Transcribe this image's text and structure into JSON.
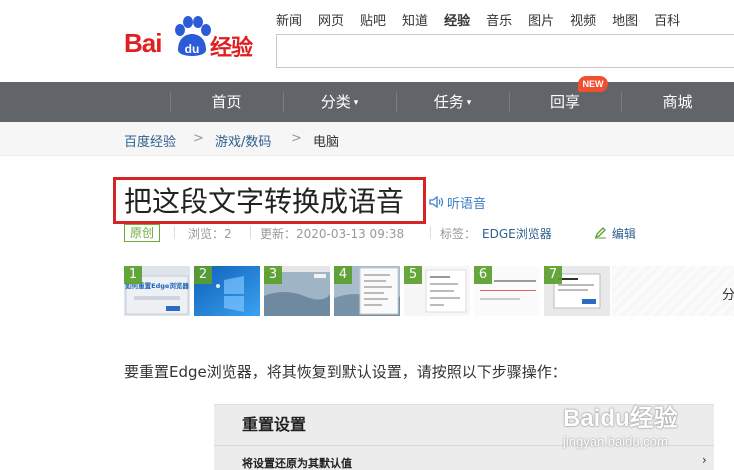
{
  "brand": {
    "logo_bai": "Bai",
    "logo_du": "du",
    "logo_jingyan": "经验",
    "watermark_text": "Baidu经验",
    "watermark_url": "jingyan.baidu.com"
  },
  "top_nav": {
    "items": [
      "新闻",
      "网页",
      "贴吧",
      "知道",
      "经验",
      "音乐",
      "图片",
      "视频",
      "地图",
      "百科"
    ],
    "active_index": 4
  },
  "main_nav": {
    "items": [
      {
        "label": "首页",
        "caret": ""
      },
      {
        "label": "分类",
        "caret": "▾"
      },
      {
        "label": "任务",
        "caret": "▾"
      },
      {
        "label": "回享",
        "caret": ""
      },
      {
        "label": "商城",
        "caret": ""
      }
    ],
    "new_badge": "NEW"
  },
  "breadcrumb": {
    "items": [
      "百度经验",
      "游戏/数码",
      "电脑"
    ],
    "separator": ">"
  },
  "article": {
    "title": "把这段文字转换成语音",
    "listen_label": "听语音",
    "original_badge": "原创",
    "views": "浏览：2",
    "updated": "更新：2020-03-13 09:38",
    "tags_label": "标签：",
    "tag": "EDGE浏览器",
    "edit_label": "编辑",
    "intro": "要重置Edge浏览器，将其恢复到默认设置，请按照以下步骤操作：",
    "more_label": "分"
  },
  "thumbnails": [
    {
      "num": "1",
      "caption": "如何重置Edge浏览器"
    },
    {
      "num": "2"
    },
    {
      "num": "3"
    },
    {
      "num": "4"
    },
    {
      "num": "5"
    },
    {
      "num": "6"
    },
    {
      "num": "7"
    }
  ],
  "screenshot": {
    "heading": "重置设置",
    "row": "将设置还原为其默认值",
    "chevron": "›"
  },
  "colors": {
    "brand_red": "#e02020",
    "nav_bg": "#616468",
    "link": "#2d5f8f",
    "green": "#5aa02c",
    "title_box": "#d42626"
  }
}
